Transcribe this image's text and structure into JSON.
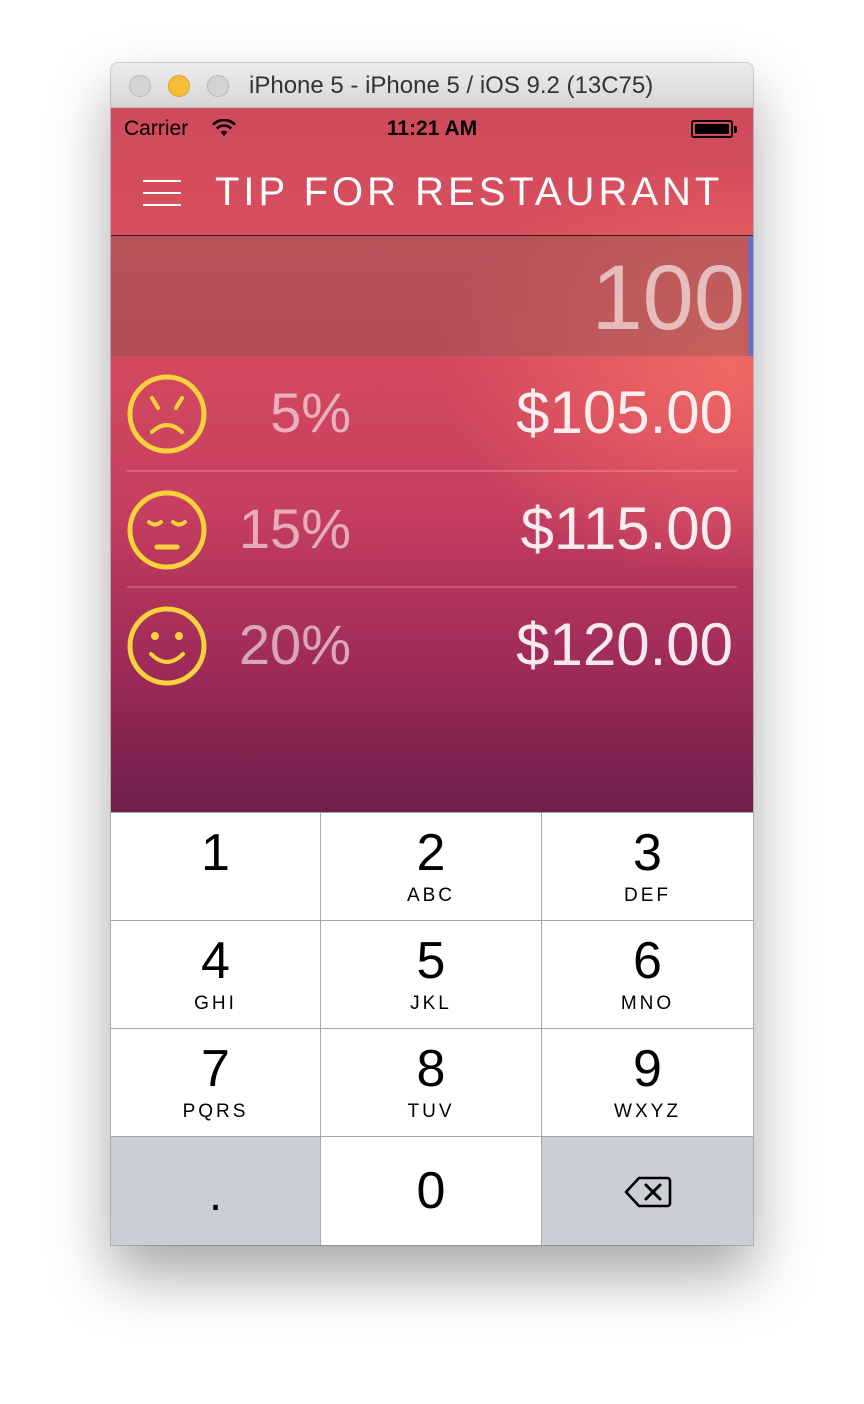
{
  "window": {
    "title": "iPhone 5 - iPhone 5 / iOS 9.2 (13C75)"
  },
  "status_bar": {
    "carrier": "Carrier",
    "time": "11:21 AM"
  },
  "nav": {
    "title": "TIP FOR RESTAURANT",
    "menu_icon": "hamburger-menu-icon"
  },
  "amount": {
    "value": "100"
  },
  "tips": [
    {
      "face": "sad",
      "percent": "5%",
      "total": "$105.00"
    },
    {
      "face": "neutral",
      "percent": "15%",
      "total": "$115.00"
    },
    {
      "face": "happy",
      "percent": "20%",
      "total": "$120.00"
    }
  ],
  "keypad": {
    "keys": [
      {
        "digit": "1",
        "letters": ""
      },
      {
        "digit": "2",
        "letters": "ABC"
      },
      {
        "digit": "3",
        "letters": "DEF"
      },
      {
        "digit": "4",
        "letters": "GHI"
      },
      {
        "digit": "5",
        "letters": "JKL"
      },
      {
        "digit": "6",
        "letters": "MNO"
      },
      {
        "digit": "7",
        "letters": "PQRS"
      },
      {
        "digit": "8",
        "letters": "TUV"
      },
      {
        "digit": "9",
        "letters": "WXYZ"
      }
    ],
    "decimal": ".",
    "zero": "0",
    "delete_icon": "backspace-icon"
  },
  "colors": {
    "face_yellow": "#f9d23c",
    "cursor_blue": "#5a6ee0",
    "keypad_gray": "#cbced6"
  }
}
